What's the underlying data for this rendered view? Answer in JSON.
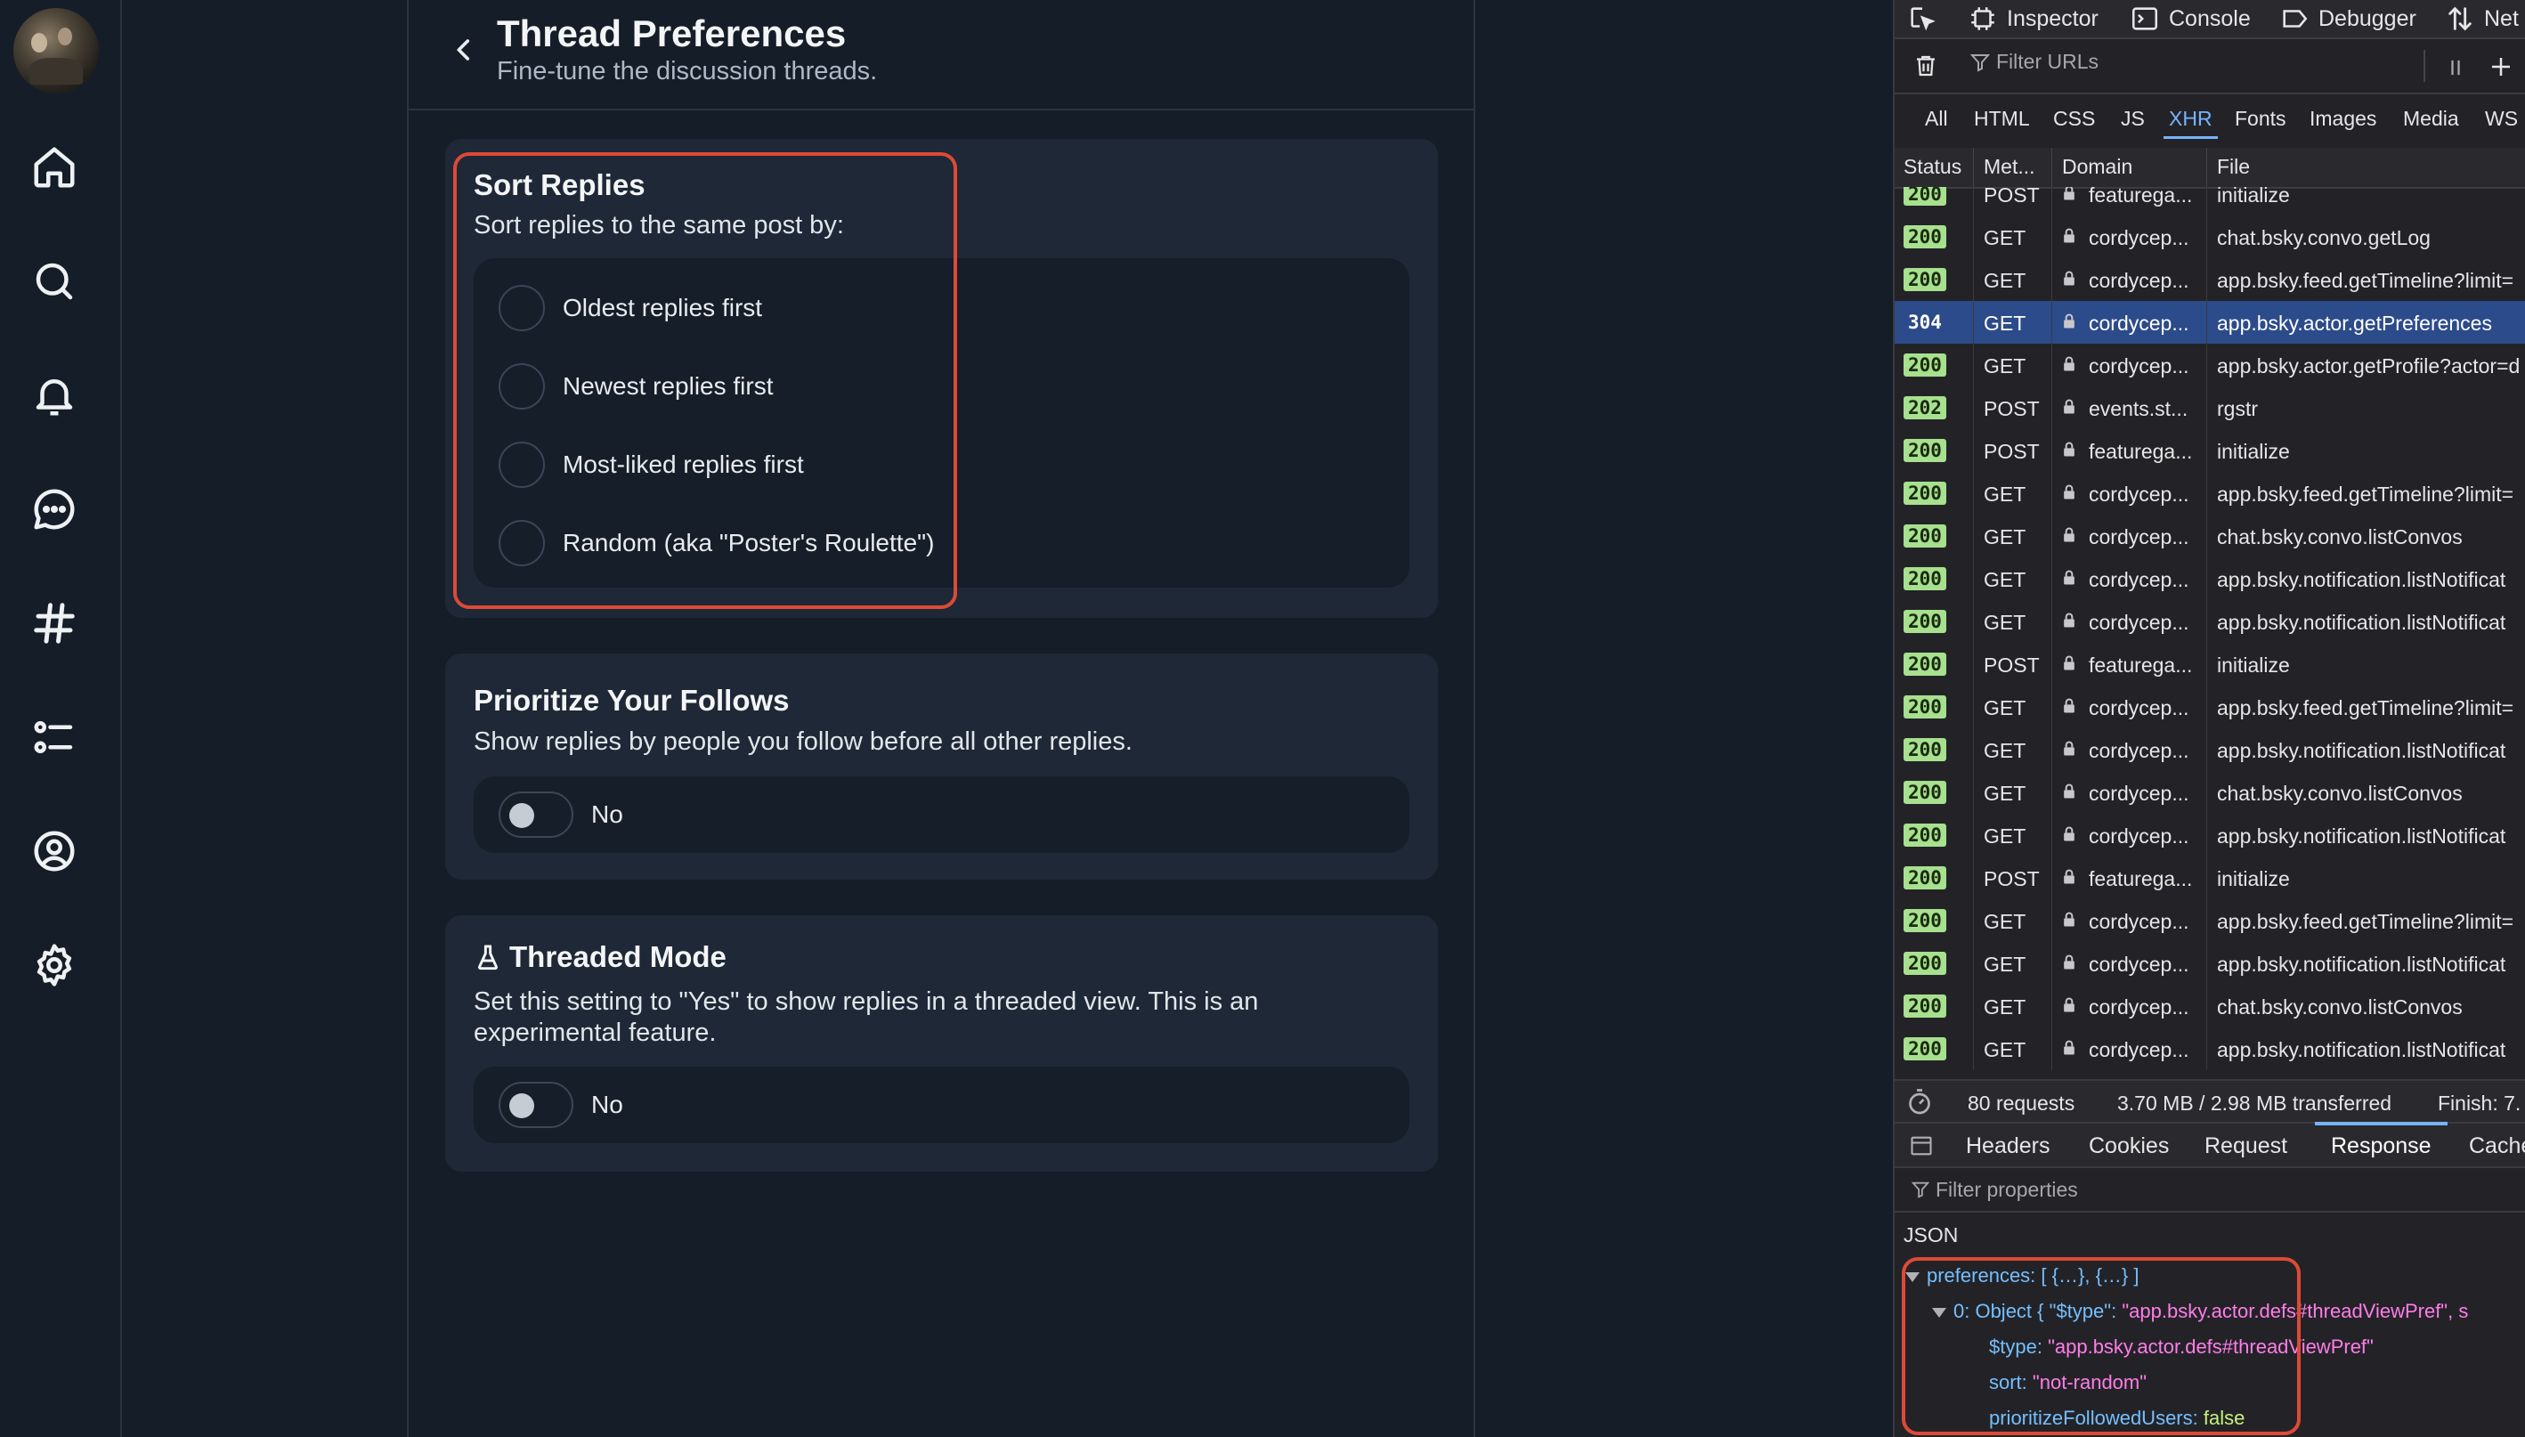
{
  "nav": {
    "items": [
      {
        "name": "home",
        "icon": "home-icon"
      },
      {
        "name": "search",
        "icon": "search-icon"
      },
      {
        "name": "notifications",
        "icon": "bell-icon"
      },
      {
        "name": "chat",
        "icon": "chat-bubble-icon"
      },
      {
        "name": "feeds",
        "icon": "hashtag-icon"
      },
      {
        "name": "lists",
        "icon": "list-icon"
      },
      {
        "name": "profile",
        "icon": "user-circle-icon"
      },
      {
        "name": "settings",
        "icon": "gear-icon"
      }
    ]
  },
  "header": {
    "title": "Thread Preferences",
    "subtitle": "Fine-tune the discussion threads."
  },
  "sort_replies": {
    "title": "Sort Replies",
    "description": "Sort replies to the same post by:",
    "options": [
      {
        "label": "Oldest replies first",
        "selected": false
      },
      {
        "label": "Newest replies first",
        "selected": false
      },
      {
        "label": "Most-liked replies first",
        "selected": false
      },
      {
        "label": "Random (aka \"Poster's Roulette\")",
        "selected": false
      }
    ]
  },
  "prioritize_follows": {
    "title": "Prioritize Your Follows",
    "description": "Show replies by people you follow before all other replies.",
    "toggle_label": "No",
    "enabled": false
  },
  "threaded_mode": {
    "icon": "flask-icon",
    "title": "Threaded Mode",
    "description": "Set this setting to \"Yes\" to show replies in a threaded view. This is an experimental feature.",
    "toggle_label": "No",
    "enabled": false
  },
  "devtools": {
    "tabs": {
      "inspector": "Inspector",
      "console": "Console",
      "debugger": "Debugger",
      "network": "Net"
    },
    "filter_placeholder": "Filter URLs",
    "type_filters": [
      "All",
      "HTML",
      "CSS",
      "JS",
      "XHR",
      "Fonts",
      "Images",
      "Media",
      "WS"
    ],
    "selected_type_filter": "XHR",
    "columns": {
      "status": "Status",
      "method": "Met...",
      "domain": "Domain",
      "file": "File"
    },
    "requests": [
      {
        "status": "200",
        "method": "POST",
        "domain": "featurega...",
        "file": "initialize"
      },
      {
        "status": "200",
        "method": "GET",
        "domain": "cordycep...",
        "file": "chat.bsky.convo.getLog"
      },
      {
        "status": "200",
        "method": "GET",
        "domain": "cordycep...",
        "file": "app.bsky.feed.getTimeline?limit="
      },
      {
        "status": "304",
        "method": "GET",
        "domain": "cordycep...",
        "file": "app.bsky.actor.getPreferences",
        "selected": true
      },
      {
        "status": "200",
        "method": "GET",
        "domain": "cordycep...",
        "file": "app.bsky.actor.getProfile?actor=d"
      },
      {
        "status": "202",
        "method": "POST",
        "domain": "events.st...",
        "file": "rgstr"
      },
      {
        "status": "200",
        "method": "POST",
        "domain": "featurega...",
        "file": "initialize"
      },
      {
        "status": "200",
        "method": "GET",
        "domain": "cordycep...",
        "file": "app.bsky.feed.getTimeline?limit="
      },
      {
        "status": "200",
        "method": "GET",
        "domain": "cordycep...",
        "file": "chat.bsky.convo.listConvos"
      },
      {
        "status": "200",
        "method": "GET",
        "domain": "cordycep...",
        "file": "app.bsky.notification.listNotificat"
      },
      {
        "status": "200",
        "method": "GET",
        "domain": "cordycep...",
        "file": "app.bsky.notification.listNotificat"
      },
      {
        "status": "200",
        "method": "POST",
        "domain": "featurega...",
        "file": "initialize"
      },
      {
        "status": "200",
        "method": "GET",
        "domain": "cordycep...",
        "file": "app.bsky.feed.getTimeline?limit="
      },
      {
        "status": "200",
        "method": "GET",
        "domain": "cordycep...",
        "file": "app.bsky.notification.listNotificat"
      },
      {
        "status": "200",
        "method": "GET",
        "domain": "cordycep...",
        "file": "chat.bsky.convo.listConvos"
      },
      {
        "status": "200",
        "method": "GET",
        "domain": "cordycep...",
        "file": "app.bsky.notification.listNotificat"
      },
      {
        "status": "200",
        "method": "POST",
        "domain": "featurega...",
        "file": "initialize"
      },
      {
        "status": "200",
        "method": "GET",
        "domain": "cordycep...",
        "file": "app.bsky.feed.getTimeline?limit="
      },
      {
        "status": "200",
        "method": "GET",
        "domain": "cordycep...",
        "file": "app.bsky.notification.listNotificat"
      },
      {
        "status": "200",
        "method": "GET",
        "domain": "cordycep...",
        "file": "chat.bsky.convo.listConvos"
      },
      {
        "status": "200",
        "method": "GET",
        "domain": "cordycep...",
        "file": "app.bsky.notification.listNotificat"
      }
    ],
    "summary": {
      "requests": "80 requests",
      "transferred": "3.70 MB / 2.98 MB transferred",
      "finish": "Finish: 7."
    },
    "detail_tabs": [
      "Headers",
      "Cookies",
      "Request",
      "Response",
      "Cache"
    ],
    "selected_detail_tab": "Response",
    "property_filter": "Filter properties",
    "json_label": "JSON",
    "json": {
      "line1_key": "preferences:",
      "line1_value": "[ {…}, {…} ]",
      "line2_key": "0: Object {",
      "line2_inner_key": "\"$type\":",
      "line2_value": "\"app.bsky.actor.defs#threadViewPref\", s",
      "line3_key": "$type:",
      "line3_value": "\"app.bsky.actor.defs#threadViewPref\"",
      "line4_key": "sort:",
      "line4_value": "\"not-random\"",
      "line5_key": "prioritizeFollowedUsers:",
      "line5_value": "false"
    }
  }
}
